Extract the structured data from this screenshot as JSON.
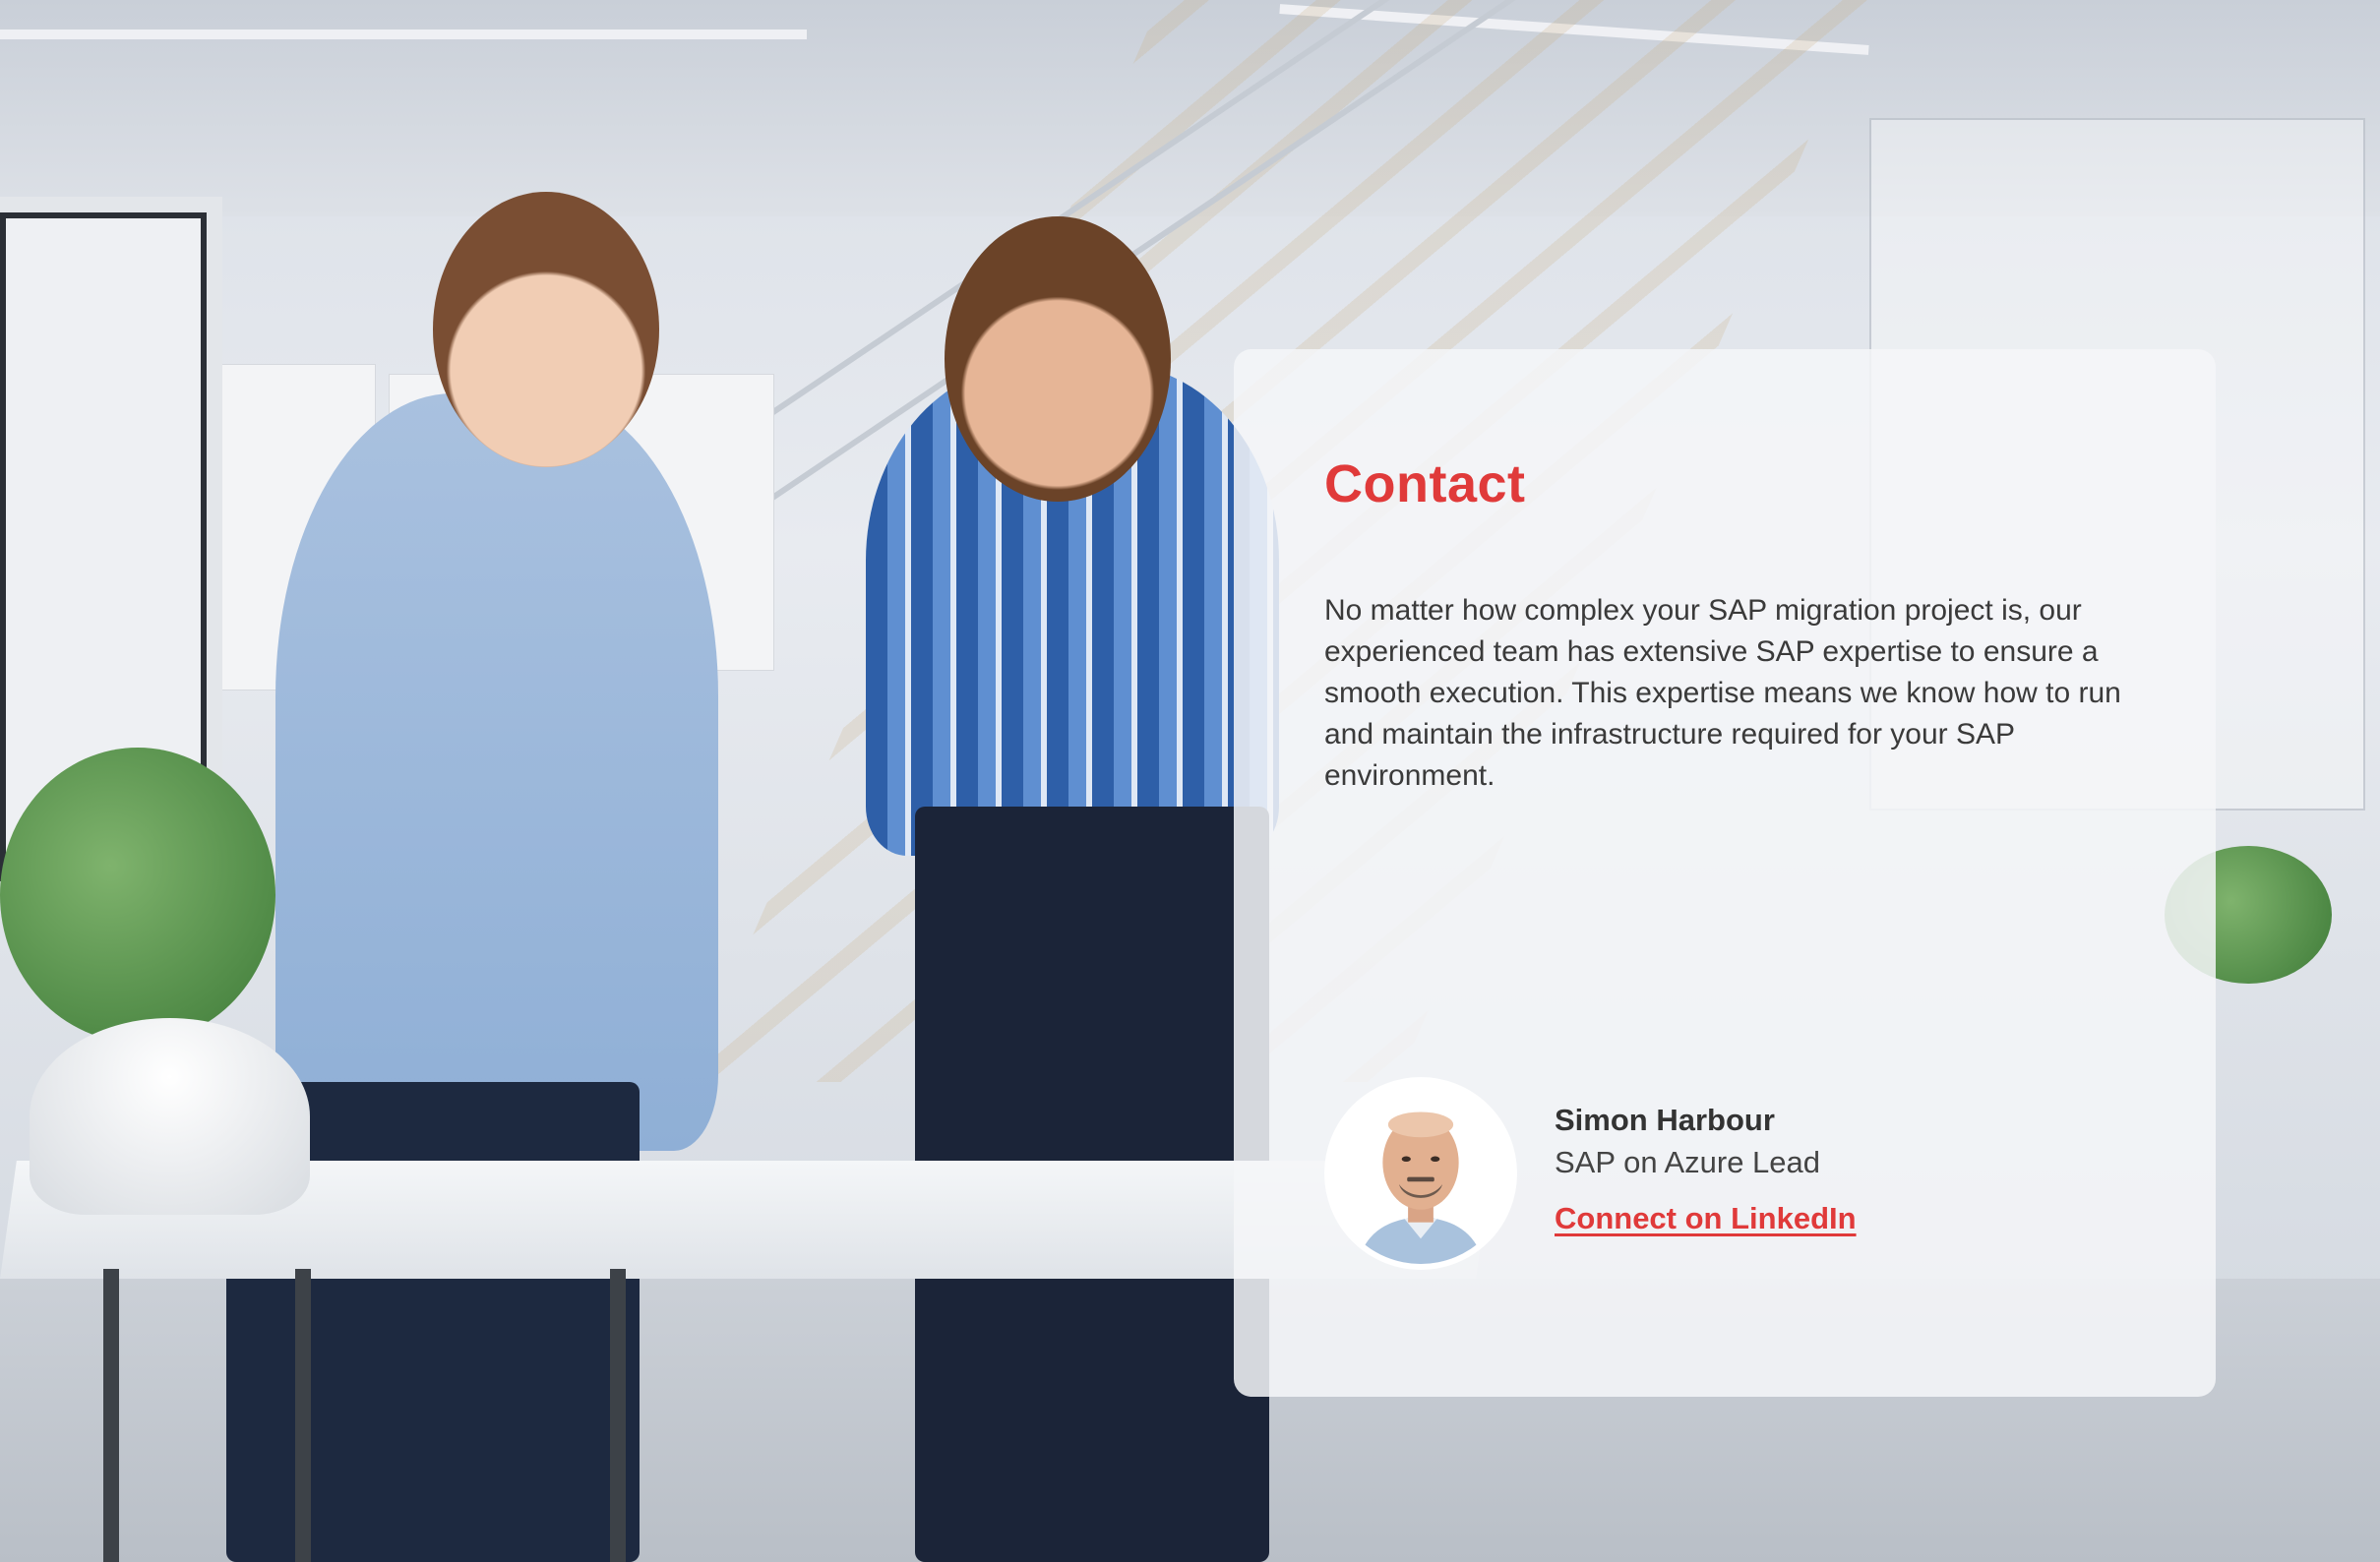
{
  "colors": {
    "accent": "#e03a3a",
    "body_text": "#3a3a3a",
    "card_background": "rgba(245,246,248,0.86)"
  },
  "contact": {
    "title": "Contact",
    "body": "No matter how complex your SAP migration project is, our experienced team has extensive SAP expertise to ensure a smooth execution. This expertise means we know how to run and maintain the infrastructure required for your SAP environment.",
    "person": {
      "name": "Simon Harbour",
      "role": "SAP on Azure Lead",
      "link_label": "Connect on LinkedIn"
    }
  }
}
